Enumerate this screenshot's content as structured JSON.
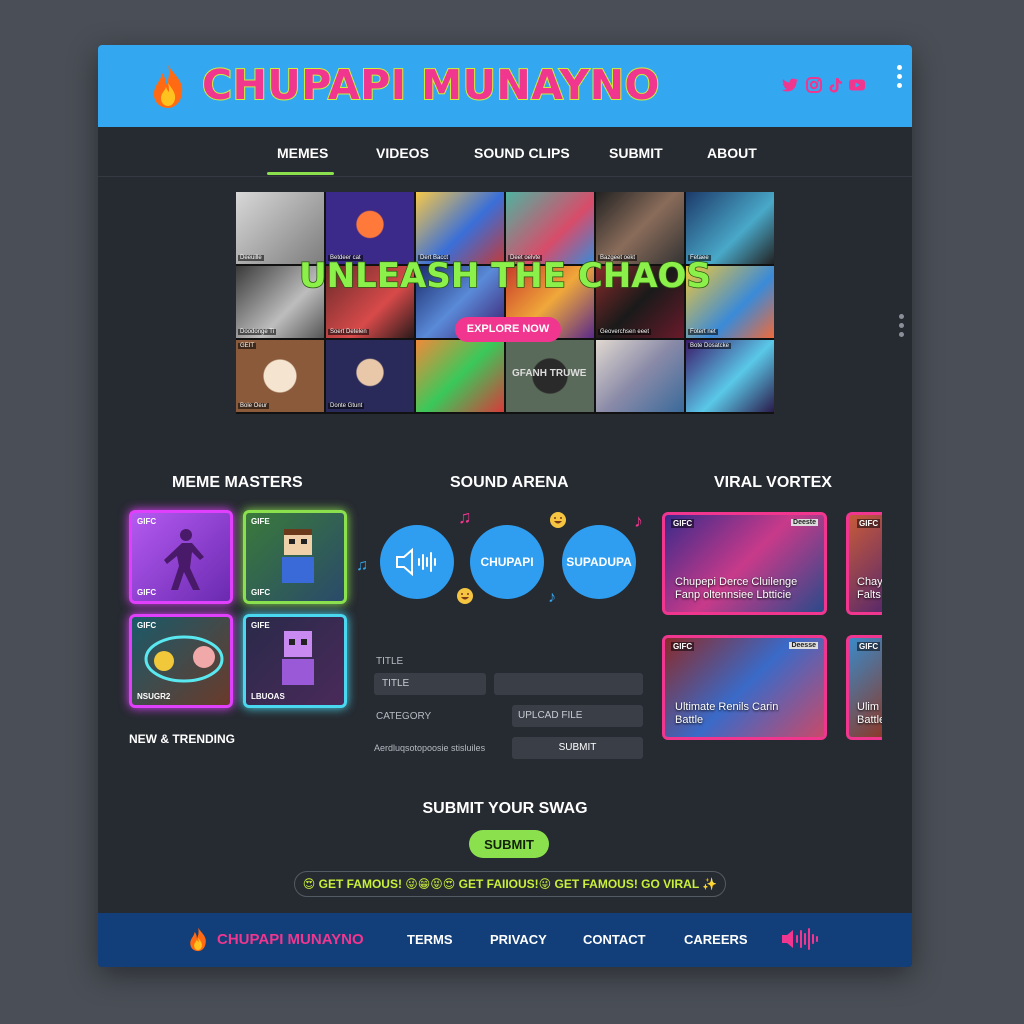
{
  "header": {
    "title": "CHUPAPI MUNAYNO",
    "social_icons": [
      "twitter-icon",
      "instagram-icon",
      "tiktok-icon",
      "youtube-icon"
    ],
    "accent": "#f0368f",
    "bar_color": "#33a8f0"
  },
  "nav": {
    "items": [
      "MEMES",
      "VIDEOS",
      "SOUND CLIPS",
      "SUBMIT",
      "ABOUT"
    ],
    "active": "MEMES"
  },
  "hero": {
    "title": "UNLEASH THE CHAOS",
    "cta": "EXPLORE NOW",
    "captions": [
      "Deeuille",
      "Betdeer cat",
      "Dert Bacct",
      "Deet oelvte",
      "Bazgeet oekt",
      "Fetaee",
      "Doodonge Ti",
      "Soert Detelen",
      "Geoverchsen eeet",
      "Fotert net",
      "GEIT",
      "Bole Oeur",
      "Donte Gtunt",
      "Bote Dosatcke"
    ],
    "center_tile_text": "GFANH TRUWE"
  },
  "meme_masters": {
    "title": "MEME MASTERS",
    "cards": [
      {
        "top": "GIFC",
        "bottom": "GIFC"
      },
      {
        "top": "GIFE",
        "bottom": "GIFC"
      },
      {
        "top": "GIFC",
        "bottom": "NSUGR2"
      },
      {
        "top": "GIFE",
        "bottom": "LBUOAS"
      }
    ],
    "footer_label": "NEW & TRENDING"
  },
  "sound_arena": {
    "title": "SOUND ARENA",
    "circles": [
      "CHUPAPI",
      "SUPADUPA"
    ],
    "form": {
      "title_label": "TITLE",
      "title_placeholder": "TITLE",
      "category_label": "CATEGORY",
      "upload_label": "UPLCAD FILE",
      "extra_label": "Aerdluqsotopoosie stisluiles",
      "submit_label": "SUBMIT"
    }
  },
  "viral_vortex": {
    "title": "VIRAL VORTEX",
    "cards": [
      {
        "tag": "GIFC",
        "badge": "Deeste",
        "text": "Chupepi Derce Cluilenge\nFanp oltennsiee Lbtticie"
      },
      {
        "tag": "GIFC",
        "badge": "Deesse",
        "text": "Ultimate Renils Carin\nBattle"
      }
    ],
    "partial_cards": [
      {
        "tag": "GIFC",
        "text": "Chay\nFalts"
      },
      {
        "tag": "GIFC",
        "text": "Ulim\nBattle"
      }
    ]
  },
  "submit_section": {
    "title": "SUBMIT YOUR SWAG",
    "button": "SUBMIT",
    "ticker": "😍 GET FAMOUS! 😜😁😝😍 GET FAIIOUS!😜 GET FAMOUS! GO VIRAL ✨"
  },
  "footer": {
    "logo": "CHUPAPI MUNAYNO",
    "links": [
      "TERMS",
      "PRIVACY",
      "CONTACT",
      "CAREERS"
    ],
    "bg": "#123f7a"
  }
}
